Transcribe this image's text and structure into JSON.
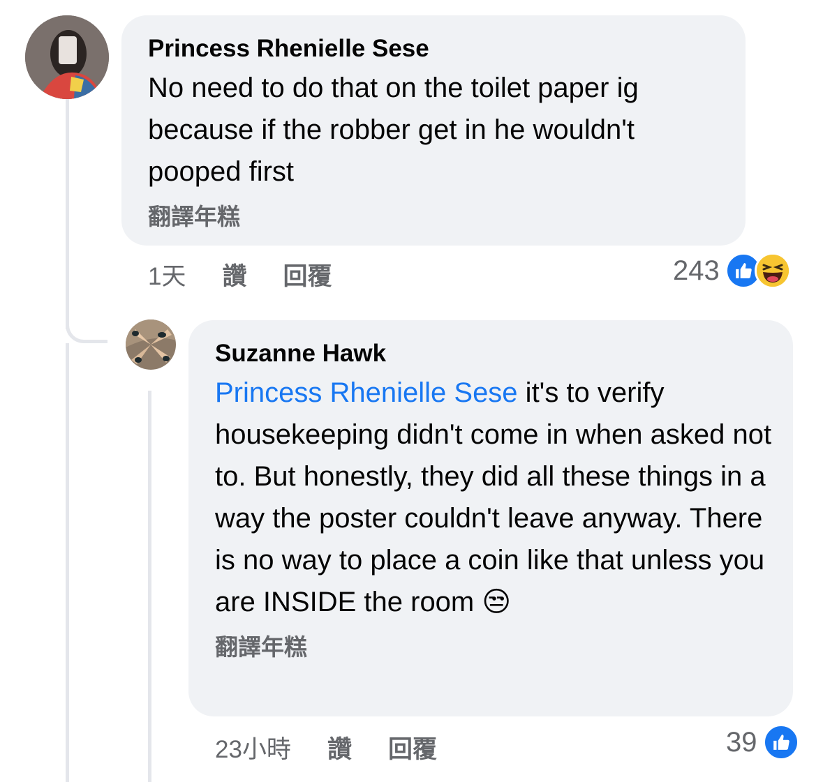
{
  "comments": [
    {
      "author": "Princess Rhenielle Sese",
      "text": "No need to do that on the toilet paper ig because if the robber get in he wouldn't pooped first",
      "translate_label": "翻譯年糕",
      "time": "1天",
      "like_label": "讚",
      "reply_label": "回覆",
      "reaction_count": "243",
      "reactions": [
        "like-icon",
        "haha-icon"
      ]
    },
    {
      "author": "Suzanne Hawk",
      "mention": "Princess Rhenielle Sese",
      "text": " it's to verify housekeeping didn't come in when asked not to. But honestly, they did all these things in a way the poster couldn't leave anyway. There is no way to place a coin like that unless you are INSIDE the room",
      "emoji": "😒",
      "translate_label": "翻譯年糕",
      "time": "23小時",
      "like_label": "讚",
      "reply_label": "回覆",
      "reaction_count": "39",
      "reactions": [
        "like-icon"
      ]
    }
  ],
  "colors": {
    "accent": "#1877f2",
    "bubble": "#f0f2f5",
    "meta": "#65676b"
  }
}
